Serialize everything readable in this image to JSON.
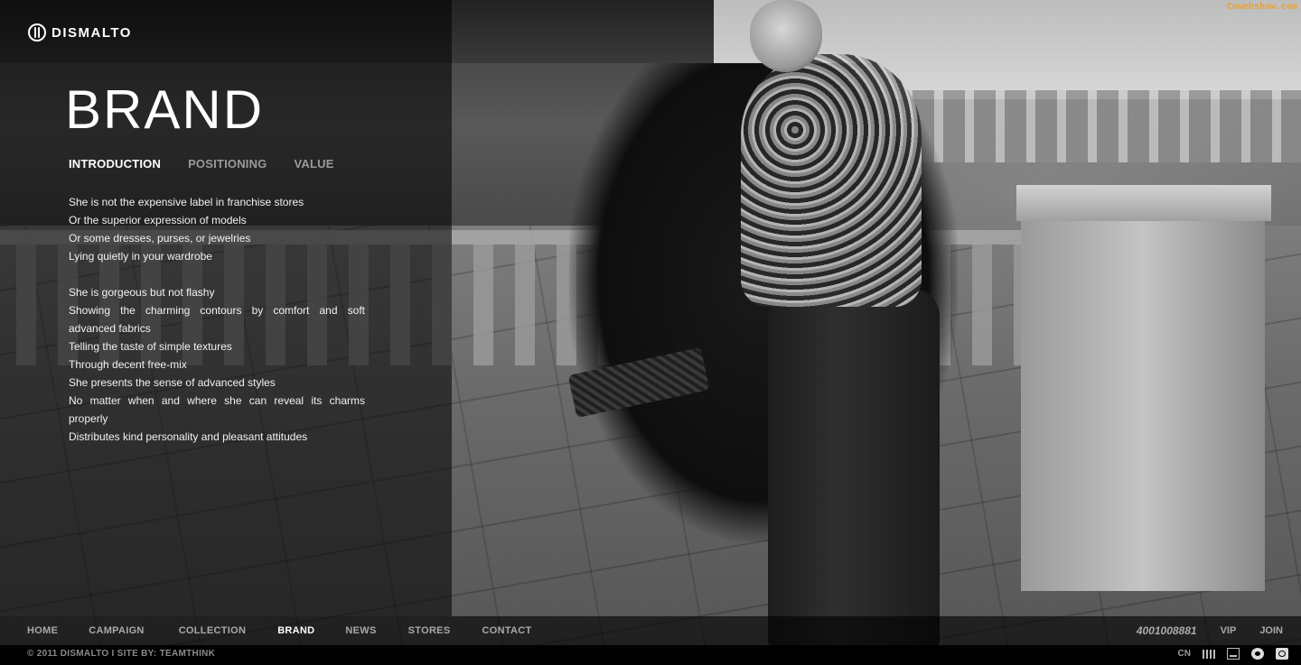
{
  "brand": {
    "logo_text": "DISMALTO"
  },
  "watermark": "Cnwebshow.com",
  "page": {
    "title": "BRAND"
  },
  "subnav": {
    "items": [
      "INTRODUCTION",
      "POSITIONING",
      "VALUE"
    ],
    "active": "INTRODUCTION"
  },
  "copy": {
    "paragraph1": [
      "She is not the expensive label in franchise stores",
      "Or the superior expression of models",
      "Or some dresses, purses, or jewelries",
      "Lying quietly in your wardrobe"
    ],
    "paragraph2": [
      "She is gorgeous but not flashy",
      "Showing the charming contours by comfort and soft advanced fabrics",
      "Telling the taste of simple textures",
      "Through decent free-mix",
      "She presents the sense of advanced styles",
      "No matter when and where she can reveal its charms properly",
      "Distributes kind personality and pleasant attitudes"
    ]
  },
  "mainnav": {
    "items": [
      "HOME",
      "CAMPAIGN",
      "COLLECTION",
      "BRAND",
      "NEWS",
      "STORES",
      "CONTACT"
    ],
    "active": "BRAND",
    "phone": "4001008881",
    "vip": "VIP",
    "join": "JOIN"
  },
  "footer": {
    "copyright": "© 2011 DISMALTO I SITE BY: TEAMTHINK",
    "lang": "CN",
    "icons": [
      "bars-icon",
      "box-icon",
      "weibo-icon",
      "chat-icon"
    ]
  },
  "colors": {
    "watermark": "#e8a13a",
    "nav_inactive": "#a9a9a9",
    "nav_active": "#ffffff"
  }
}
